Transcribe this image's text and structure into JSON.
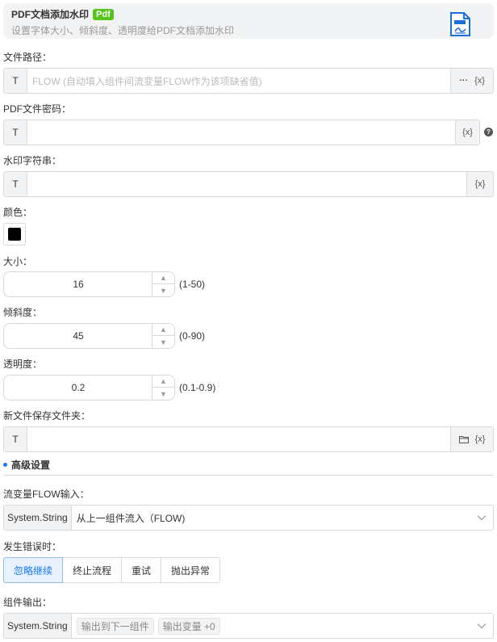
{
  "header": {
    "title": "PDF文档添加水印",
    "badge": "Pdf",
    "subtitle": "设置字体大小、倾斜度、透明度给PDF文档添加水印",
    "icon": "pdf-document-icon"
  },
  "file_path": {
    "label": "文件路径：",
    "prefix": "T",
    "placeholder": "FLOW (自动填入组件间流变量FLOW作为该项缺省值)",
    "more": "···",
    "var": "{x}"
  },
  "pdf_password": {
    "label": "PDF文件密码：",
    "prefix": "T",
    "var": "{x}",
    "help": "?"
  },
  "watermark_text": {
    "label": "水印字符串：",
    "prefix": "T",
    "var": "{x}"
  },
  "color": {
    "label": "颜色：",
    "value": "#000000"
  },
  "size": {
    "label": "大小：",
    "value": "16",
    "range": "(1-50)"
  },
  "tilt": {
    "label": "倾斜度：",
    "value": "45",
    "range": "(0-90)"
  },
  "opacity": {
    "label": "透明度：",
    "value": "0.2",
    "range": "(0.1-0.9)"
  },
  "save_folder": {
    "label": "新文件保存文件夹：",
    "prefix": "T",
    "var": "{x}",
    "icon": "folder-icon"
  },
  "advanced": {
    "title": "高级设置"
  },
  "flow_input": {
    "label": "流变量FLOW输入：",
    "type": "System.String",
    "value": "从上一组件流入（FLOW)"
  },
  "on_error": {
    "label": "发生错误时：",
    "options": [
      "忽略继续",
      "终止流程",
      "重试",
      "抛出异常"
    ],
    "selected": "忽略继续"
  },
  "output": {
    "label": "组件输出：",
    "type": "System.String",
    "tags": [
      "输出到下一组件",
      "输出变量 +0"
    ]
  },
  "colors": {
    "accent": "#1677ff",
    "badge": "#52c41a"
  }
}
